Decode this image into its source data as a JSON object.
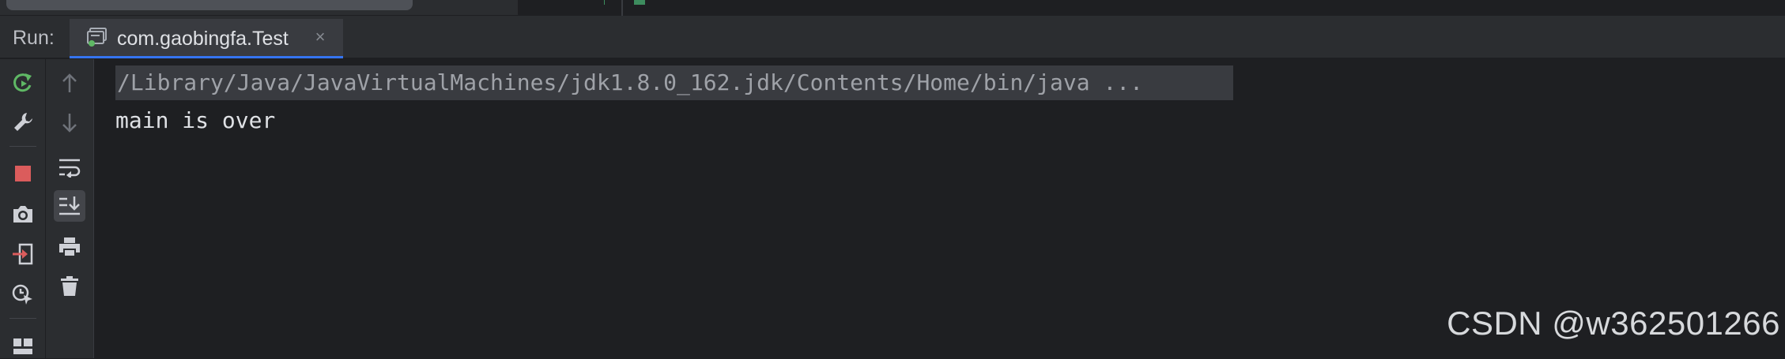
{
  "run_panel": {
    "title": "Run:",
    "tab": {
      "label": "com.gaobingfa.Test",
      "icon": "console-icon",
      "close_icon": "close-icon"
    }
  },
  "left_toolbar": [
    {
      "name": "rerun-icon"
    },
    {
      "name": "settings-wrench-icon"
    },
    {
      "name": "stop-icon"
    },
    {
      "name": "camera-icon"
    },
    {
      "name": "exit-icon"
    },
    {
      "name": "coverage-icon"
    },
    {
      "name": "layout-icon"
    }
  ],
  "right_toolbar": [
    {
      "name": "up-arrow-icon"
    },
    {
      "name": "down-arrow-icon"
    },
    {
      "name": "soft-wrap-icon"
    },
    {
      "name": "scroll-to-end-icon"
    },
    {
      "name": "print-icon"
    },
    {
      "name": "trash-icon"
    }
  ],
  "console": {
    "command": "/Library/Java/JavaVirtualMachines/jdk1.8.0_162.jdk/Contents/Home/bin/java ...",
    "output": "main is over"
  },
  "watermark": "CSDN @w362501266",
  "colors": {
    "background": "#1e1f22",
    "panel": "#2b2d30",
    "accent": "#3574f0",
    "rerun_green": "#5fb865",
    "stop_red": "#db5c5c"
  }
}
